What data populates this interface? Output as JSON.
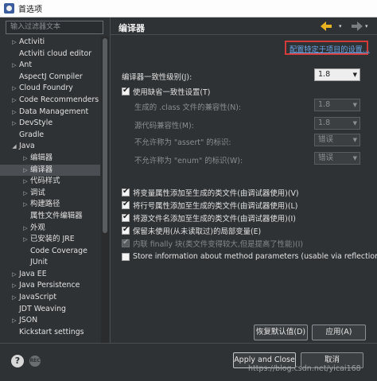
{
  "window": {
    "title": "首选项"
  },
  "filter": {
    "placeholder": "输入过滤器文本"
  },
  "tree": [
    {
      "label": "Activiti",
      "arrow": "▷",
      "indent": 0,
      "selected": false
    },
    {
      "label": "Activiti cloud editor",
      "arrow": "",
      "indent": 0,
      "selected": false
    },
    {
      "label": "Ant",
      "arrow": "▷",
      "indent": 0,
      "selected": false
    },
    {
      "label": "AspectJ Compiler",
      "arrow": "",
      "indent": 0,
      "selected": false
    },
    {
      "label": "Cloud Foundry",
      "arrow": "▷",
      "indent": 0,
      "selected": false
    },
    {
      "label": "Code Recommenders",
      "arrow": "▷",
      "indent": 0,
      "selected": false
    },
    {
      "label": "Data Management",
      "arrow": "▷",
      "indent": 0,
      "selected": false
    },
    {
      "label": "DevStyle",
      "arrow": "▷",
      "indent": 0,
      "selected": false
    },
    {
      "label": "Gradle",
      "arrow": "",
      "indent": 0,
      "selected": false
    },
    {
      "label": "Java",
      "arrow": "◢",
      "indent": 0,
      "selected": false
    },
    {
      "label": "编辑器",
      "arrow": "▷",
      "indent": 1,
      "selected": false
    },
    {
      "label": "编译器",
      "arrow": "▷",
      "indent": 1,
      "selected": true
    },
    {
      "label": "代码样式",
      "arrow": "▷",
      "indent": 1,
      "selected": false
    },
    {
      "label": "调试",
      "arrow": "▷",
      "indent": 1,
      "selected": false
    },
    {
      "label": "构建路径",
      "arrow": "▷",
      "indent": 1,
      "selected": false
    },
    {
      "label": "属性文件编辑器",
      "arrow": "",
      "indent": 1,
      "selected": false
    },
    {
      "label": "外观",
      "arrow": "▷",
      "indent": 1,
      "selected": false
    },
    {
      "label": "已安装的 JRE",
      "arrow": "▷",
      "indent": 1,
      "selected": false
    },
    {
      "label": "Code Coverage",
      "arrow": "",
      "indent": 1,
      "selected": false
    },
    {
      "label": "JUnit",
      "arrow": "",
      "indent": 1,
      "selected": false
    },
    {
      "label": "Java EE",
      "arrow": "▷",
      "indent": 0,
      "selected": false
    },
    {
      "label": "Java Persistence",
      "arrow": "▷",
      "indent": 0,
      "selected": false
    },
    {
      "label": "JavaScript",
      "arrow": "▷",
      "indent": 0,
      "selected": false
    },
    {
      "label": "JDT Weaving",
      "arrow": "",
      "indent": 0,
      "selected": false
    },
    {
      "label": "JSON",
      "arrow": "▷",
      "indent": 0,
      "selected": false
    },
    {
      "label": "Kickstart settings",
      "arrow": "",
      "indent": 0,
      "selected": false
    }
  ],
  "panel": {
    "title": "编译器",
    "project_link": "配置特定于项目的设置...",
    "compliance_label": "编译器一致性级别(J):",
    "compliance_value": "1.8",
    "use_default_label": "使用缺省一致性设置(T)",
    "generated_class_label": "生成的 .class 文件的兼容性(N):",
    "generated_class_value": "1.8",
    "source_compat_label": "源代码兼容性(M):",
    "source_compat_value": "1.8",
    "assert_label": "不允许称为 \"assert\" 的标识:",
    "assert_value": "错误",
    "enum_label": "不允许称为 \"enum\" 的标识(W):",
    "enum_value": "错误",
    "options": [
      {
        "label": "将变量属性添加至生成的类文件(由调试器使用)(V)",
        "checked": true,
        "dim": false
      },
      {
        "label": "将行号属性添加至生成的类文件(由调试器使用)(L)",
        "checked": true,
        "dim": false
      },
      {
        "label": "将源文件名添加至生成的类文件(由调试器使用)(I)",
        "checked": true,
        "dim": false
      },
      {
        "label": "保留未使用(从未读取过)的局部变量(E)",
        "checked": true,
        "dim": false
      },
      {
        "label": "内联 finally 块(类文件变得较大,但是提高了性能)(I)",
        "checked": true,
        "dim": true
      },
      {
        "label": "Store information about method parameters (usable via reflection)",
        "checked": false,
        "dim": false
      }
    ],
    "restore_defaults": "恢复默认值(D)",
    "apply": "应用(A)"
  },
  "footer": {
    "help": "?",
    "rec": "REC",
    "apply_close": "Apply and Close",
    "cancel": "取消",
    "watermark": "https://blog.csdn.net/yicai168"
  },
  "colors": {
    "accent_arrow": "#e8b320",
    "link": "#6aa5e8",
    "highlight_box": "#d33a3a"
  }
}
